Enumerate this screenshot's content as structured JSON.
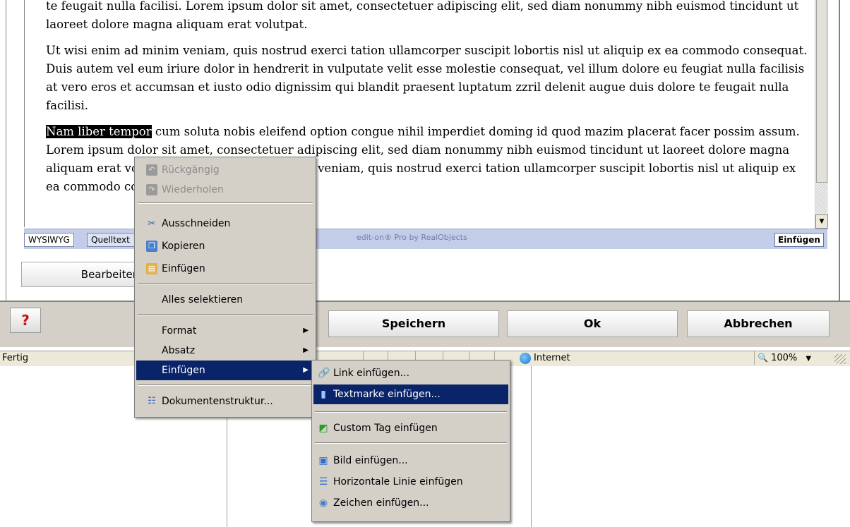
{
  "editor": {
    "paragraphs": [
      "te feugait nulla facilisi. Lorem ipsum dolor sit amet, consectetuer adipiscing elit, sed diam nonummy nibh euismod tincidunt ut laoreet dolore magna aliquam erat volutpat.",
      "Ut wisi enim ad minim veniam, quis nostrud exerci tation ullamcorper suscipit lobortis nisl ut aliquip ex ea commodo consequat. Duis autem vel eum iriure dolor in hendrerit in vulputate velit esse molestie consequat, vel illum dolore eu feugiat nulla facilisis at vero eros et accumsan et iusto odio dignissim qui blandit praesent luptatum zzril delenit augue duis dolore te feugait nulla facilisi."
    ],
    "selected_text": "Nam liber tempor",
    "last_paragraph_rest": " cum soluta nobis eleifend option congue nihil imperdiet doming id quod mazim placerat facer possim assum. Lorem ipsum dolor sit amet, consectetuer adipiscing elit, sed diam nonummy nibh euismod tincidunt ut laoreet dolore magna aliquam erat volutpat. Ut wisi enim ad minim veniam, quis nostrud exerci tation ullamcorper suscipit lobortis nisl ut aliquip ex ea commodo consequat.",
    "tabs": {
      "wysiwyg": "WYSIWYG",
      "source": "Quelltext"
    },
    "brand": "edit-on® Pro by RealObjects",
    "mode": "Einfügen",
    "edit_button": "Bearbeiten"
  },
  "dialog_buttons": {
    "help": "?",
    "save": "Speichern",
    "ok": "Ok",
    "cancel": "Abbrechen"
  },
  "browser_status": {
    "text": "Fertig",
    "zone": "Internet",
    "zoom": "100%"
  },
  "context_menu": {
    "undo": "Rückgängig",
    "redo": "Wiederholen",
    "cut": "Ausschneiden",
    "copy": "Kopieren",
    "paste": "Einfügen",
    "select_all": "Alles selektieren",
    "format": "Format",
    "paragraph": "Absatz",
    "insert": "Einfügen",
    "doc_structure": "Dokumentenstruktur..."
  },
  "insert_submenu": {
    "link": "Link einfügen...",
    "bookmark": "Textmarke einfügen...",
    "custom_tag": "Custom Tag einfügen",
    "image": "Bild einfügen...",
    "hr": "Horizontale Linie einfügen",
    "char": "Zeichen einfügen..."
  },
  "colors": {
    "menu_highlight": "#0a246a",
    "menu_bg": "#d4d0c8",
    "editor_status_bg": "#c3cde8"
  }
}
